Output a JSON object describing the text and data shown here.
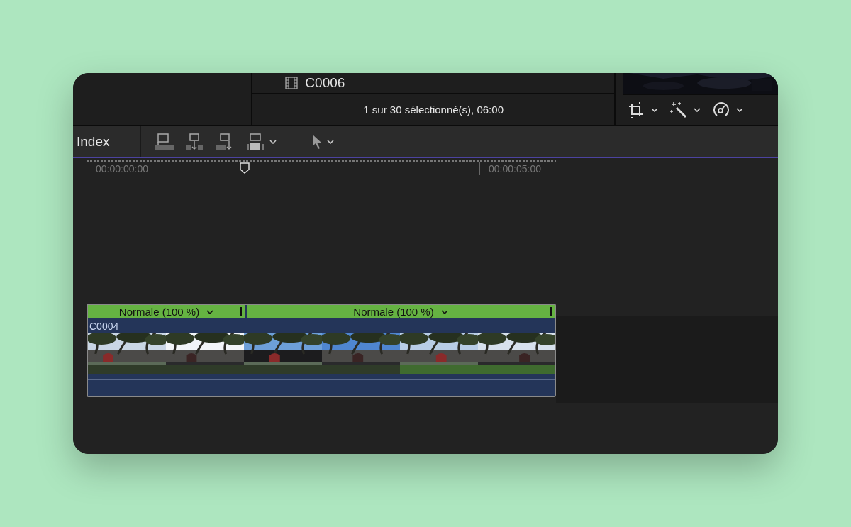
{
  "viewer": {
    "clip_name": "C0006",
    "status": "1 sur 30 sélectionné(s), 06:00"
  },
  "toolbar": {
    "index_label": "Index"
  },
  "ruler": {
    "ticks": [
      "00:00:00:00",
      "00:00:05:00"
    ]
  },
  "clip": {
    "name": "C0004",
    "speed_segments": [
      {
        "label": "Normale (100 %)"
      },
      {
        "label": "Normale (100 %)"
      }
    ]
  }
}
